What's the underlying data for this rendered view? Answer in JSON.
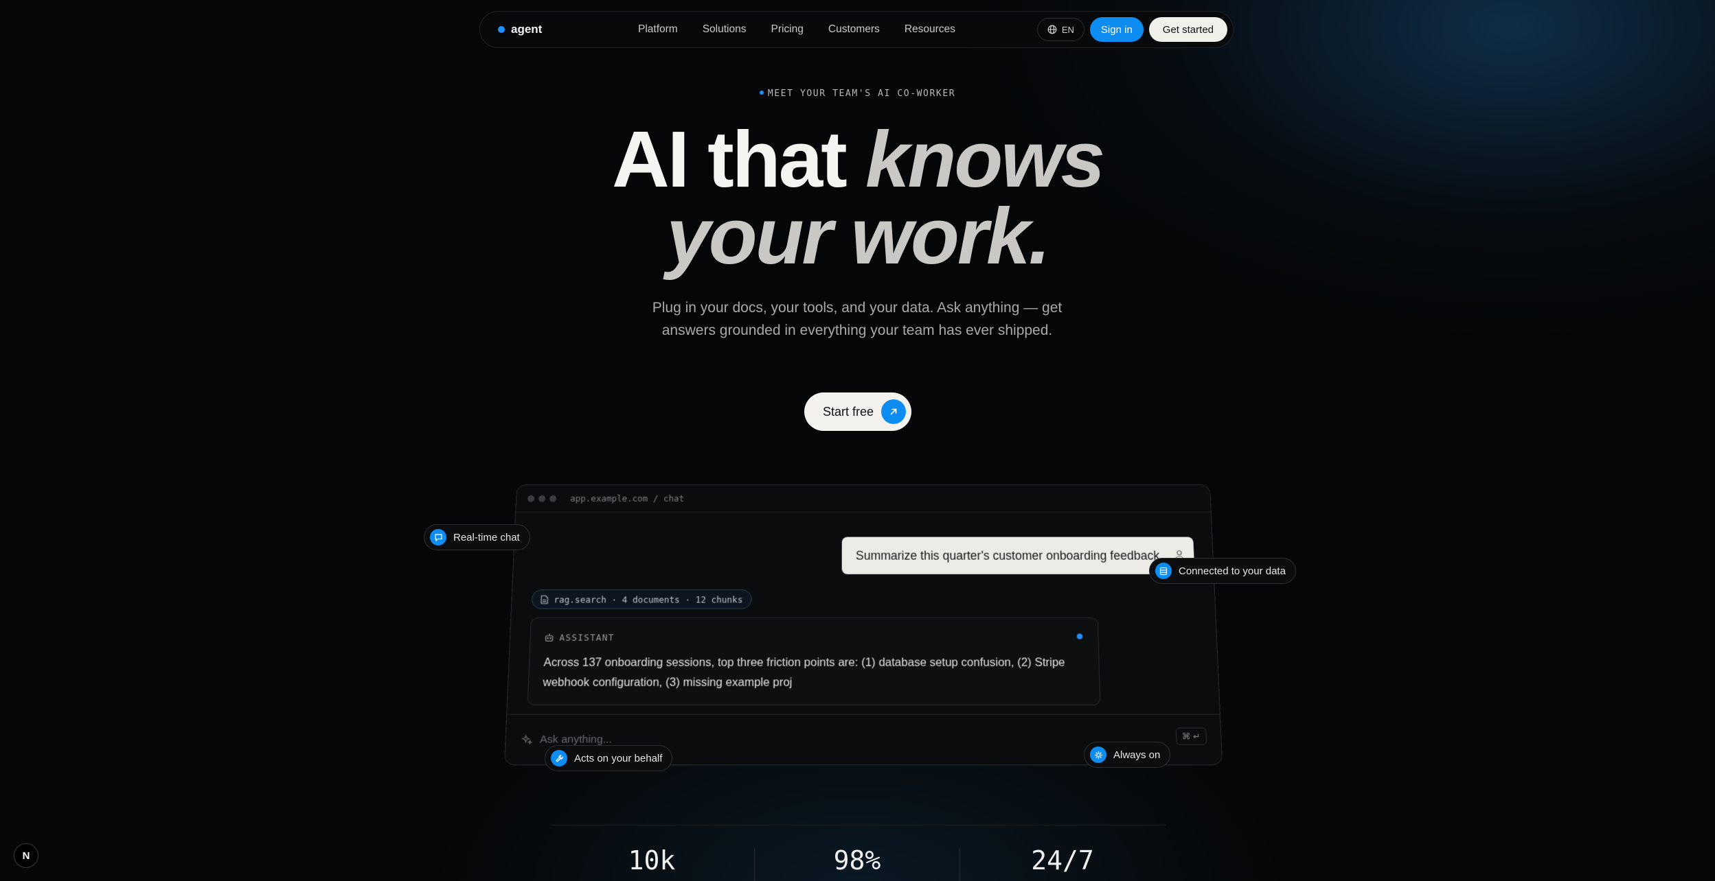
{
  "nav": {
    "brand": "agent",
    "links": [
      "Platform",
      "Solutions",
      "Pricing",
      "Customers",
      "Resources"
    ],
    "lang": "EN",
    "signin": "Sign in",
    "get_started": "Get started"
  },
  "hero": {
    "eyebrow": "MEET YOUR TEAM'S AI CO-WORKER",
    "headline_plain": "AI that ",
    "headline_em1": "knows",
    "headline_em2": "your work.",
    "subhead": "Plug in your docs, your tools, and your data. Ask anything — get answers grounded in everything your team has ever shipped.",
    "cta": "Start free"
  },
  "window": {
    "url": "app.example.com / chat",
    "user_message": "Summarize this quarter's customer onboarding feedback.",
    "tool_call": "rag.search · 4 documents · 12 chunks",
    "assistant_label": "ASSISTANT",
    "assistant_text": "Across 137 onboarding sessions, top three friction points are: (1) database setup confusion, (2) Stripe webhook configuration, (3) missing example proj",
    "input_placeholder": "Ask anything...",
    "shortcut": "⌘ ↵"
  },
  "chips": {
    "realtime": "Real-time chat",
    "connected": "Connected to your data",
    "acts": "Acts on your behalf",
    "always": "Always on"
  },
  "stats": [
    "10k",
    "98%",
    "24/7"
  ],
  "corner_badge": "N",
  "colors": {
    "accent": "#0d8cf2",
    "background": "#050607",
    "light_button": "#f0efea"
  }
}
